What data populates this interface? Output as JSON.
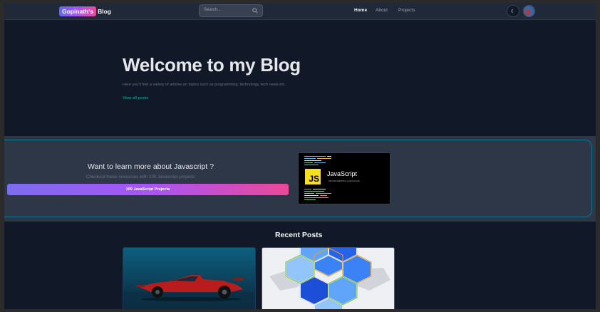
{
  "header": {
    "logo_badge": "Gopinath's",
    "logo_text": "Blog",
    "search_placeholder": "Search...",
    "nav": {
      "home": "Home",
      "about": "About",
      "projects": "Projects"
    },
    "theme_toggle_icon": "moon-icon"
  },
  "hero": {
    "title": "Welcome to my Blog",
    "subtitle": "Here you'll find a variety of articles on topics such as programming, technology, tech news etc.",
    "link": "View all posts"
  },
  "banner": {
    "title": "Want to learn more about Javascript ?",
    "subtitle": "Checkout these resources with 100 Javascript projects",
    "button": "100 JavaScript Projects",
    "image_logo": "JS",
    "image_title": "JavaScript",
    "image_sub": "PROGRAMMING LANGUAGE"
  },
  "recent": {
    "title": "Recent Posts"
  },
  "colors": {
    "accent_teal": "#0d9488",
    "gradient_start": "#7c6cf0",
    "gradient_end": "#ec4899",
    "page_bg": "#111827"
  }
}
